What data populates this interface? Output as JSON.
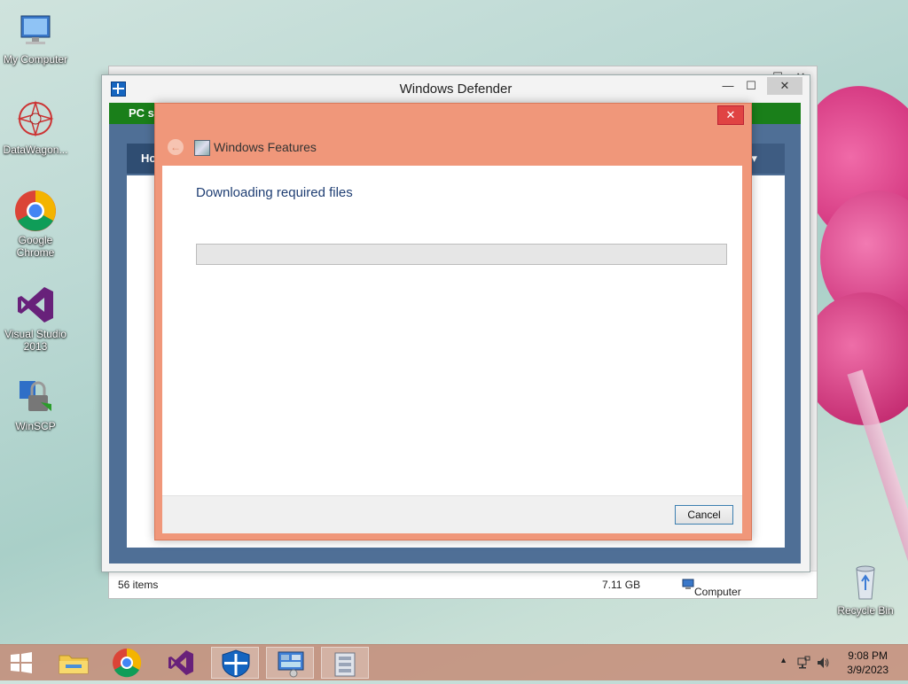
{
  "desktop": {
    "icons": [
      {
        "label": "My Computer"
      },
      {
        "label": "DataWagon..."
      },
      {
        "label": "Google Chrome"
      },
      {
        "label": "Visual Studio 2013"
      },
      {
        "label": "WinSCP"
      },
      {
        "label": "Recycle Bin"
      }
    ]
  },
  "explorer": {
    "status": {
      "items": "56 items",
      "size": "7.11 GB",
      "location": "Computer"
    }
  },
  "defender": {
    "title": "Windows Defender",
    "green_banner": "PC st",
    "tab_home": "Ho",
    "tab_help": "elp ▾",
    "minimize": "—",
    "maximize": "☐",
    "close": "✕"
  },
  "features": {
    "title": "Windows Features",
    "heading": "Downloading required files",
    "progress_percent": 0,
    "cancel_label": "Cancel",
    "close": "✕",
    "back": "←"
  },
  "taskbar": {
    "items": [
      "start-button",
      "file-explorer",
      "google-chrome",
      "visual-studio",
      "windows-defender",
      "control-panel",
      "windows-features"
    ],
    "time": "9:08 PM",
    "date": "3/9/2023",
    "tray_arrow": "▲"
  }
}
